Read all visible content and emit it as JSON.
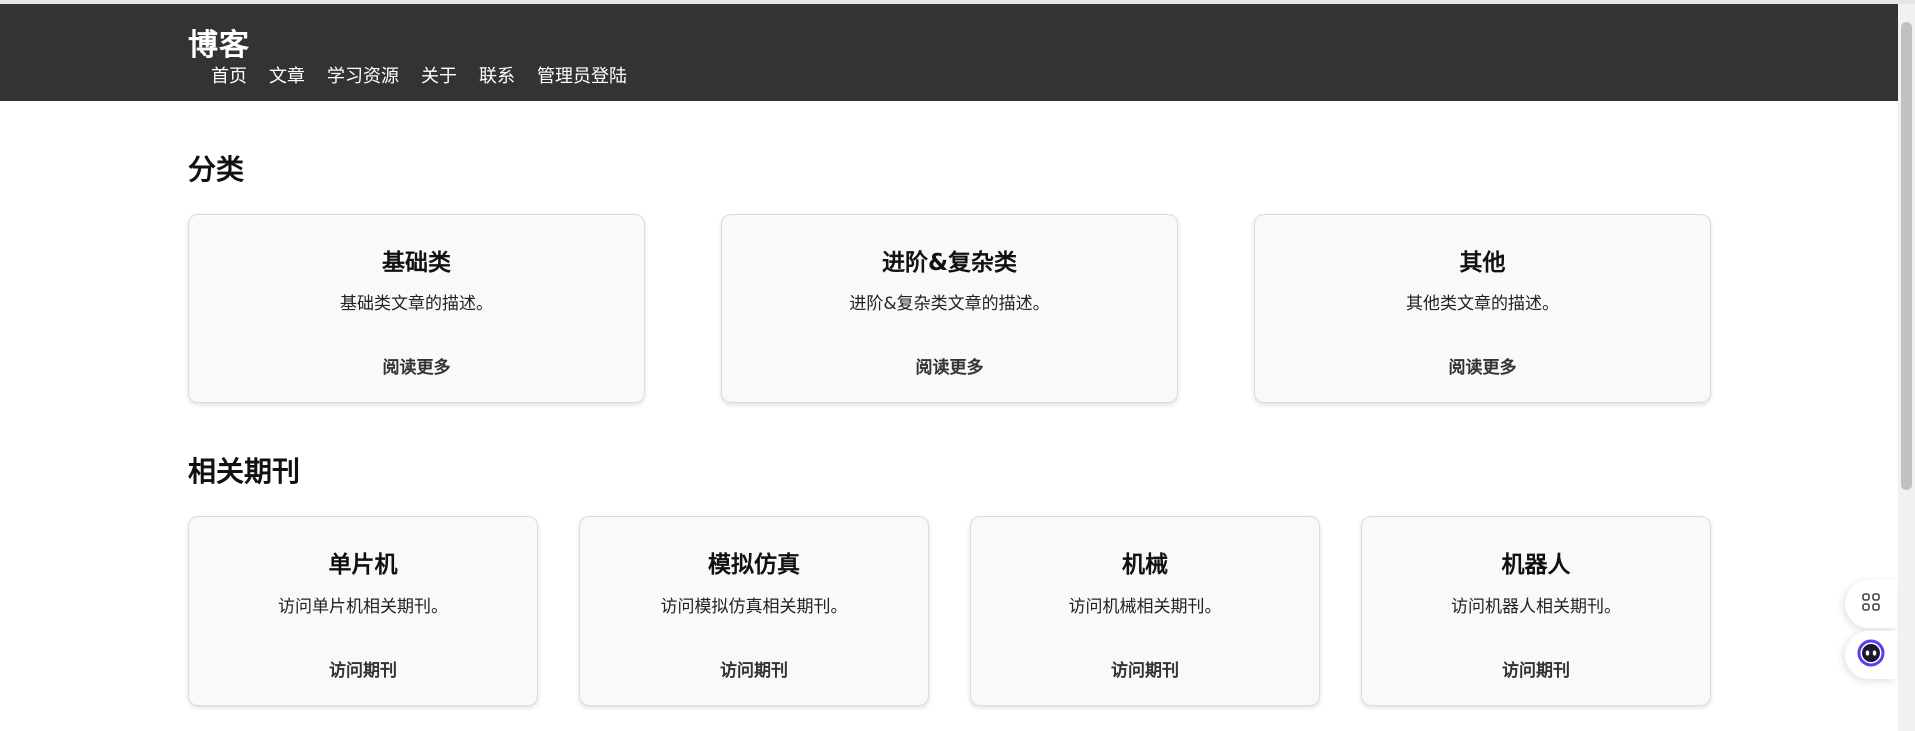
{
  "header": {
    "brand": "博客",
    "nav": [
      "首页",
      "文章",
      "学习资源",
      "关于",
      "联系",
      "管理员登陆"
    ]
  },
  "categories": {
    "title": "分类",
    "items": [
      {
        "title": "基础类",
        "desc": "基础类文章的描述。",
        "link": "阅读更多"
      },
      {
        "title": "进阶&复杂类",
        "desc": "进阶&复杂类文章的描述。",
        "link": "阅读更多"
      },
      {
        "title": "其他",
        "desc": "其他类文章的描述。",
        "link": "阅读更多"
      }
    ]
  },
  "journals": {
    "title": "相关期刊",
    "items": [
      {
        "title": "单片机",
        "desc": "访问单片机相关期刊。",
        "link": "访问期刊"
      },
      {
        "title": "模拟仿真",
        "desc": "访问模拟仿真相关期刊。",
        "link": "访问期刊"
      },
      {
        "title": "机械",
        "desc": "访问机械相关期刊。",
        "link": "访问期刊"
      },
      {
        "title": "机器人",
        "desc": "访问机器人相关期刊。",
        "link": "访问期刊"
      }
    ]
  },
  "floating": {
    "icons": [
      "grid-apps-icon",
      "assistant-bot-icon"
    ]
  },
  "colors": {
    "header_bg": "#333333",
    "card_bg": "#f9f9f9",
    "assistant_accent": "#5b3df5"
  }
}
